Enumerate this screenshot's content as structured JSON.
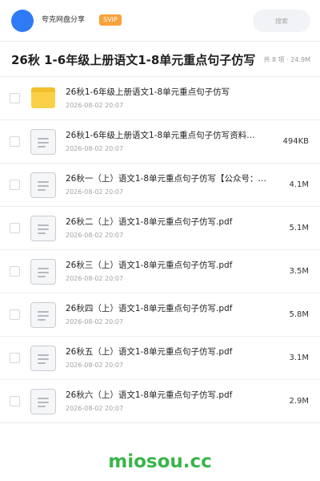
{
  "header": {
    "username": "夸克网盘分享",
    "badge": "SVIP",
    "search_placeholder": "搜索"
  },
  "folder": {
    "title": "26秋 1-6年级上册语文1-8单元重点句子仿写",
    "meta": "共 8 项 · 24.9M"
  },
  "files": [
    {
      "name": "26秋1-6年级上册语文1-8单元重点句子仿写",
      "date": "2026-08-02 20:07",
      "size": "",
      "icon": "folder-icon"
    },
    {
      "name": "26秋1-6年级上册语文1-8单元重点句子仿写资料…",
      "date": "2026-08-02 20:07",
      "size": "494KB",
      "icon": "document-icon"
    },
    {
      "name": "26秋一（上）语文1-8单元重点句子仿写【公众号：…",
      "date": "2026-08-02 20:07",
      "size": "4.1M",
      "icon": "document-icon"
    },
    {
      "name": "26秋二（上）语文1-8单元重点句子仿写.pdf",
      "date": "2026-08-02 20:07",
      "size": "5.1M",
      "icon": "document-icon"
    },
    {
      "name": "26秋三（上）语文1-8单元重点句子仿写.pdf",
      "date": "2026-08-02 20:07",
      "size": "3.5M",
      "icon": "document-icon"
    },
    {
      "name": "26秋四（上）语文1-8单元重点句子仿写.pdf",
      "date": "2026-08-02 20:07",
      "size": "5.8M",
      "icon": "document-icon"
    },
    {
      "name": "26秋五（上）语文1-8单元重点句子仿写.pdf",
      "date": "2026-08-02 20:07",
      "size": "3.1M",
      "icon": "document-icon"
    },
    {
      "name": "26秋六（上）语文1-8单元重点句子仿写.pdf",
      "date": "2026-08-02 20:07",
      "size": "2.9M",
      "icon": "document-icon"
    }
  ],
  "watermark": "miosou.cc",
  "colors": {
    "accent": "#2f7bf5",
    "badge": "#f7a23b",
    "folder": "#fad146",
    "watermark": "#39b54a"
  }
}
